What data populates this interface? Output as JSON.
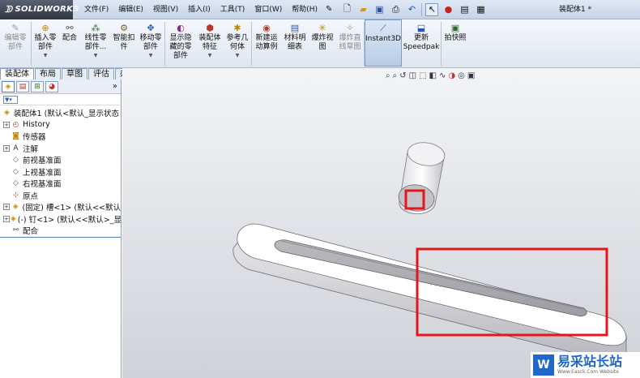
{
  "app": {
    "logo_text": "SOLIDWORKS",
    "window_title": "装配体1 *"
  },
  "menu": {
    "items": [
      "文件(F)",
      "编辑(E)",
      "视图(V)",
      "插入(I)",
      "工具(T)",
      "窗口(W)",
      "帮助(H)"
    ]
  },
  "command_manager": {
    "items": [
      {
        "label": "编辑零\n部件",
        "disabled": true,
        "dropdown": false,
        "icon": "edit-component-icon"
      },
      {
        "label": "插入零\n部件",
        "disabled": false,
        "dropdown": true,
        "icon": "insert-component-icon"
      },
      {
        "label": "配合",
        "disabled": false,
        "dropdown": false,
        "icon": "mate-icon"
      },
      {
        "label": "线性零\n部件...",
        "disabled": false,
        "dropdown": true,
        "icon": "linear-pattern-icon"
      },
      {
        "label": "智能扣\n件",
        "disabled": false,
        "dropdown": false,
        "icon": "smart-fastener-icon"
      },
      {
        "label": "移动零\n部件",
        "disabled": false,
        "dropdown": true,
        "icon": "move-component-icon"
      },
      {
        "label": "显示隐\n藏的零\n部件",
        "disabled": false,
        "dropdown": false,
        "icon": "show-hidden-icon"
      },
      {
        "label": "装配体\n特征",
        "disabled": false,
        "dropdown": true,
        "icon": "assembly-feature-icon"
      },
      {
        "label": "参考几\n何体",
        "disabled": false,
        "dropdown": true,
        "icon": "reference-geometry-icon"
      },
      {
        "label": "新建运\n动算例",
        "disabled": false,
        "dropdown": false,
        "icon": "motion-study-icon"
      },
      {
        "label": "材料明\n细表",
        "disabled": false,
        "dropdown": false,
        "icon": "bom-icon"
      },
      {
        "label": "爆炸视\n图",
        "disabled": false,
        "dropdown": false,
        "icon": "exploded-view-icon"
      },
      {
        "label": "爆炸直\n线草图",
        "disabled": true,
        "dropdown": false,
        "icon": "explode-line-icon"
      },
      {
        "label": "Instant3D",
        "disabled": false,
        "dropdown": false,
        "active": true,
        "icon": "instant3d-icon"
      },
      {
        "label": "更新\nSpeedpak",
        "disabled": false,
        "dropdown": false,
        "icon": "speedpak-icon"
      },
      {
        "label": "拍快照",
        "disabled": false,
        "dropdown": false,
        "icon": "snapshot-icon"
      }
    ]
  },
  "tabs": [
    "装配体",
    "布局",
    "草图",
    "评估",
    "办公室产品"
  ],
  "active_tab": "装配体",
  "feature_tree": {
    "panel_more": "»",
    "items": [
      {
        "label": "装配体1  (默认<默认_显示状态",
        "expander": "",
        "icon": "assembly-icon"
      },
      {
        "label": "History",
        "expander": "+",
        "icon": "history-icon"
      },
      {
        "label": "传感器",
        "expander": "",
        "icon": "sensor-icon"
      },
      {
        "label": "注解",
        "expander": "+",
        "icon": "annotation-icon"
      },
      {
        "label": "前视基准面",
        "expander": "",
        "icon": "plane-icon"
      },
      {
        "label": "上视基准面",
        "expander": "",
        "icon": "plane-icon"
      },
      {
        "label": "右视基准面",
        "expander": "",
        "icon": "plane-icon"
      },
      {
        "label": "原点",
        "expander": "",
        "icon": "origin-icon"
      },
      {
        "label": "(固定) 槽<1> (默认<<默认",
        "expander": "+",
        "icon": "part-icon"
      },
      {
        "label": "(-) 钉<1> (默认<<默认>_显",
        "expander": "+",
        "icon": "part-icon"
      },
      {
        "label": "配合",
        "expander": "",
        "icon": "mates-folder-icon"
      }
    ]
  },
  "colors": {
    "highlight": "#e4161c",
    "brand": "#1f68c9"
  },
  "watermark": {
    "logo": "W",
    "title": "易采站长站",
    "url": "Www.Easck.Com  Website"
  }
}
